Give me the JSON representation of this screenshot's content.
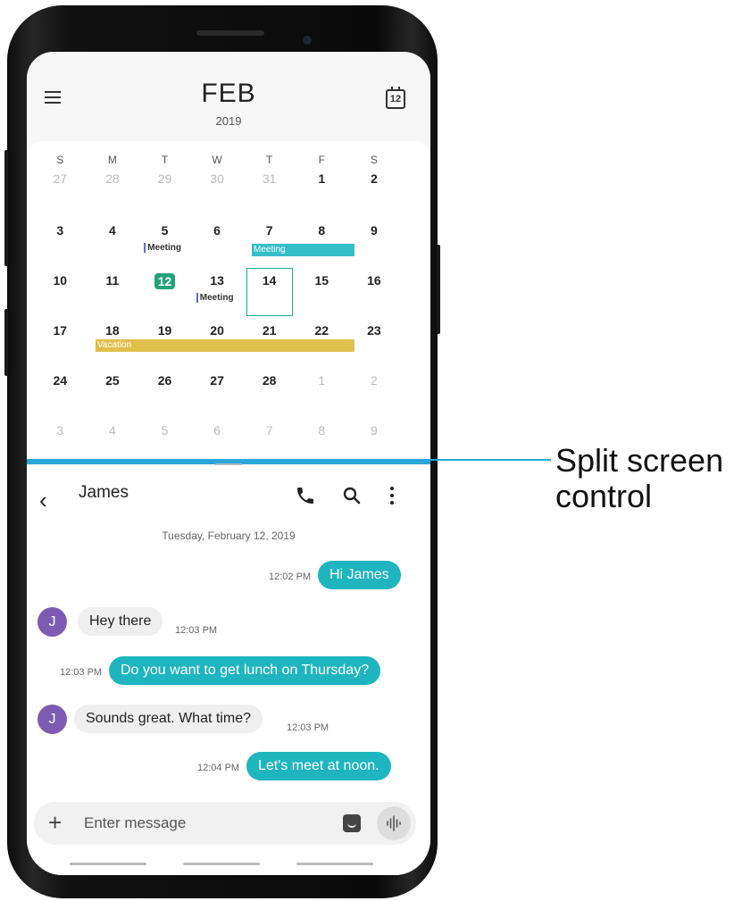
{
  "calendar": {
    "month": "FEB",
    "year": "2019",
    "icon_day": "12",
    "weekdays": [
      "S",
      "M",
      "T",
      "W",
      "T",
      "F",
      "S"
    ],
    "weeks": [
      [
        "27",
        "28",
        "29",
        "30",
        "31",
        "1",
        "2"
      ],
      [
        "3",
        "4",
        "5",
        "6",
        "7",
        "8",
        "9"
      ],
      [
        "10",
        "11",
        "12",
        "13",
        "14",
        "15",
        "16"
      ],
      [
        "17",
        "18",
        "19",
        "20",
        "21",
        "22",
        "23"
      ],
      [
        "24",
        "25",
        "26",
        "27",
        "28",
        "1",
        "2"
      ],
      [
        "3",
        "4",
        "5",
        "6",
        "7",
        "8",
        "9"
      ]
    ],
    "events": {
      "meeting_5": "Meeting",
      "meeting_7": "Meeting",
      "meeting_13": "Meeting",
      "vacation": "Vacation"
    },
    "colors": {
      "today": "#22a37a",
      "meeting_bar": "#35bec9",
      "vacation_bar": "#e0c04c",
      "event_marker": "#5b6fd4"
    },
    "fab_label": "+"
  },
  "messages": {
    "contact": "James",
    "date": "Tuesday, February 12, 2019",
    "avatar_letter": "J",
    "thread": [
      {
        "text": "Hi James",
        "time": "12:02 PM",
        "direction": "out"
      },
      {
        "text": "Hey there",
        "time": "12:03 PM",
        "direction": "in"
      },
      {
        "text": "Do you want to get lunch on Thursday?",
        "time": "12:03 PM",
        "direction": "out"
      },
      {
        "text": "Sounds great. What time?",
        "time": "12:03 PM",
        "direction": "in"
      },
      {
        "text": "Let's meet at noon.",
        "time": "12:04 PM",
        "direction": "out"
      }
    ],
    "input_placeholder": "Enter message",
    "icons": [
      "back-icon",
      "phone-icon",
      "search-icon",
      "more-icon",
      "plus-icon",
      "sticker-icon",
      "voice-icon"
    ],
    "colors": {
      "outgoing": "#1eb5bf",
      "incoming": "#efefef",
      "avatar": "#7d5bb3"
    }
  },
  "annotation": {
    "line1": "Split screen",
    "line2": "control",
    "color": "#2aa6d8"
  }
}
